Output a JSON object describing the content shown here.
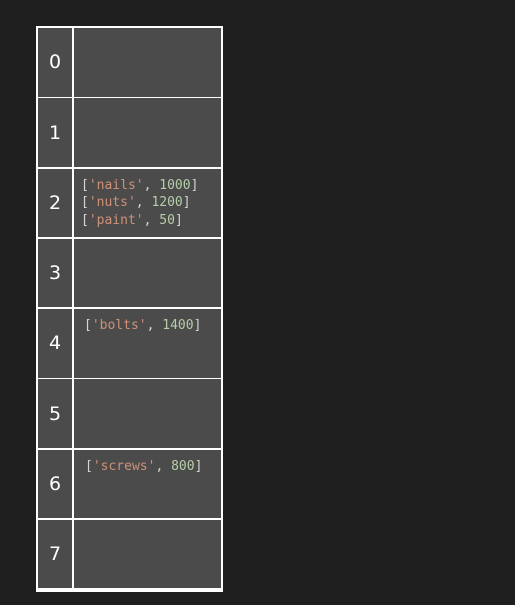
{
  "buckets": [
    {
      "index": "0",
      "entries": []
    },
    {
      "index": "1",
      "entries": []
    },
    {
      "index": "2",
      "entries": [
        {
          "key": "'nails'",
          "value": "1000"
        },
        {
          "key": "'nuts'",
          "value": "1200"
        },
        {
          "key": "'paint'",
          "value": "50"
        }
      ]
    },
    {
      "index": "3",
      "entries": []
    },
    {
      "index": "4",
      "entries": [
        {
          "key": "'bolts'",
          "value": "1400"
        }
      ]
    },
    {
      "index": "5",
      "entries": []
    },
    {
      "index": "6",
      "entries": [
        {
          "key": "'screws'",
          "value": "800"
        }
      ]
    },
    {
      "index": "7",
      "entries": []
    }
  ],
  "colors": {
    "background": "#1f1f1f",
    "cell": "#4b4b4b",
    "grid": "#ffffff",
    "string": "#ce9178",
    "number": "#b5cea8",
    "punctuation": "#d4d4d4"
  }
}
